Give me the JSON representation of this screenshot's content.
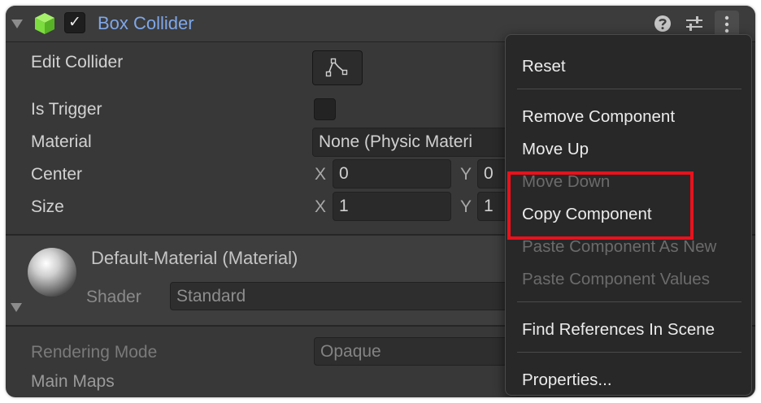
{
  "component": {
    "title": "Box Collider",
    "enabled_check": "✓",
    "fields": {
      "edit_collider": "Edit Collider",
      "is_trigger": "Is Trigger",
      "material_label": "Material",
      "material_value": "None (Physic Materi",
      "center_label": "Center",
      "center_x_axis": "X",
      "center_x": "0",
      "center_y_axis": "Y",
      "center_y": "0",
      "size_label": "Size",
      "size_x_axis": "X",
      "size_x": "1",
      "size_y_axis": "Y",
      "size_y": "1"
    }
  },
  "material_section": {
    "name": "Default-Material (Material)",
    "shader_label": "Shader",
    "shader_value": "Standard",
    "rendering_mode_label": "Rendering Mode",
    "rendering_mode_value": "Opaque",
    "main_maps": "Main Maps"
  },
  "context_menu": {
    "items": [
      {
        "label": "Reset",
        "enabled": true
      },
      {
        "label": "Remove Component",
        "enabled": true
      },
      {
        "label": "Move Up",
        "enabled": true
      },
      {
        "label": "Move Down",
        "enabled": false
      },
      {
        "label": "Copy Component",
        "enabled": true
      },
      {
        "label": "Paste Component As New",
        "enabled": false
      },
      {
        "label": "Paste Component Values",
        "enabled": false
      },
      {
        "label": "Find References In Scene",
        "enabled": true
      },
      {
        "label": "Properties...",
        "enabled": true
      }
    ],
    "highlighted_item": "Copy Component"
  },
  "colors": {
    "title_blue": "#7ea7ea",
    "panel_bg": "#383838",
    "menu_bg": "#282828",
    "highlight_red": "#e8121c",
    "cube_green": "#7ddc3f"
  },
  "icons": [
    "foldout-arrow-icon",
    "cube-icon",
    "checkbox-icon",
    "help-icon",
    "preset-sliders-icon",
    "kebab-menu-icon",
    "edit-collider-icon",
    "material-sphere-icon"
  ]
}
